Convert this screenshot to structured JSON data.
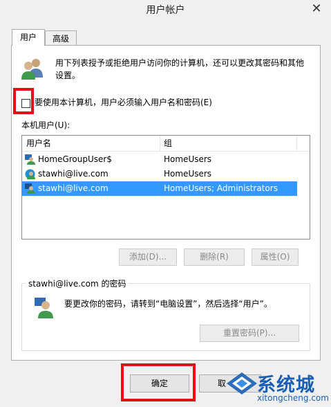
{
  "window": {
    "title": "用户帐户",
    "close_glyph": "✕"
  },
  "tabs": [
    {
      "label": "用户",
      "active": true
    },
    {
      "label": "高级",
      "active": false
    }
  ],
  "description": "用下列表授予或拒绝用户访问你的计算机，还可以更改其密码和其他设置。",
  "require_password": {
    "label": "要使用本计算机，用户必须输入用户名和密码(E)",
    "checked": false
  },
  "local_users_label": "本机用户(U):",
  "user_table": {
    "columns": [
      "用户名",
      "组"
    ],
    "rows": [
      {
        "name": "HomeGroupUser$",
        "group": "HomeUsers",
        "selected": false
      },
      {
        "name": "stawhi@live.com",
        "group": "HomeUsers",
        "selected": false
      },
      {
        "name": "stawhi@live.com",
        "group": "HomeUsers; Administrators",
        "selected": true
      }
    ]
  },
  "actions": {
    "add": "添加(D)...",
    "remove": "删除(R)",
    "properties": "属性(O)"
  },
  "password_group": {
    "title": "stawhi@live.com 的密码",
    "text": "要更改你的密码，请转到“电脑设置”，然后选择“用户”。",
    "reset_label": "重置密码(P)..."
  },
  "dialog_buttons": {
    "ok": "确定",
    "cancel": "取"
  },
  "watermark": {
    "brand": "系统城",
    "site": "xitongcheng.com"
  },
  "colors": {
    "highlight": "#e3101a",
    "selection": "#3399ff",
    "watermark": "#1a5fb4"
  },
  "icons": {
    "users": "users-icon",
    "user": "user-icon",
    "close": "close-icon"
  }
}
